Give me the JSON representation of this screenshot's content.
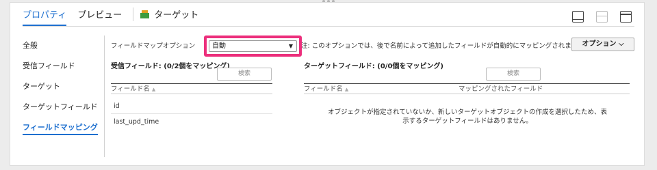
{
  "tabs": [
    {
      "label": "プロパティ",
      "active": true
    },
    {
      "label": "プレビュー",
      "active": false
    },
    {
      "label": "ターゲット",
      "active": false
    }
  ],
  "sidenav": {
    "items": [
      {
        "label": "全般"
      },
      {
        "label": "受信フィールド"
      },
      {
        "label": "ターゲット"
      },
      {
        "label": "ターゲットフィールド"
      },
      {
        "label": "フィールドマッピング",
        "active": true
      }
    ]
  },
  "mapping": {
    "option_label": "フィールドマップオプション",
    "option_value": "自動",
    "note": "注: このオプションでは、後で名前によって追加したフィールドが自動的にマッピングされます",
    "options_button": "オプション ⌵"
  },
  "incoming": {
    "title": "受信フィールド: (0/2個をマッピング)",
    "search_placeholder": "検索",
    "col_name": "フィールド名",
    "rows": [
      "id",
      "last_upd_time"
    ]
  },
  "target": {
    "title": "ターゲットフィールド: (0/0個をマッピング)",
    "search_placeholder": "検索",
    "col_name": "フィールド名",
    "col_mapped": "マッピングされたフィールド",
    "empty_line1": "オブジェクトが指定されていないか、新しいターゲットオブジェクトの作成を選択したため、表",
    "empty_line2": "示するターゲットフィールドはありません。"
  },
  "colors": {
    "accent": "#1d6fcf",
    "highlight": "#ec2f7c"
  }
}
